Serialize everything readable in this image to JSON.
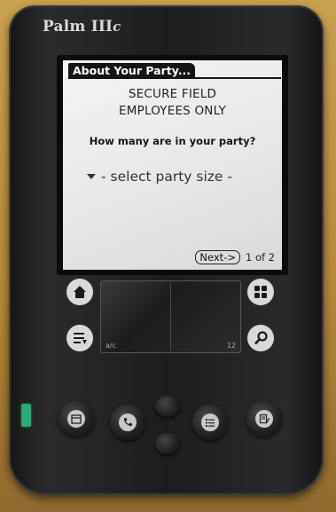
{
  "device": {
    "brand": "Palm III",
    "brand_suffix": "c"
  },
  "form": {
    "title": "About Your Party...",
    "notice_line1": "SECURE FIELD",
    "notice_line2": "EMPLOYEES ONLY",
    "question": "How many are in your party?",
    "party_size_select": "- select party size -",
    "next_button": "Next->",
    "page_indicator": "1 of 2"
  },
  "graffiti": {
    "left_label": "a/c",
    "right_label": "12"
  },
  "silkscreen_icons": [
    "home-icon",
    "find-icon",
    "menu-icon",
    "calculator-icon"
  ],
  "hardware_buttons": [
    "date-book-icon",
    "address-book-icon",
    "todo-list-icon",
    "memo-pad-icon"
  ],
  "colors": {
    "power_led": "#2aa877",
    "screen_bg": "#e8e8e6",
    "title_bar": "#151515"
  }
}
